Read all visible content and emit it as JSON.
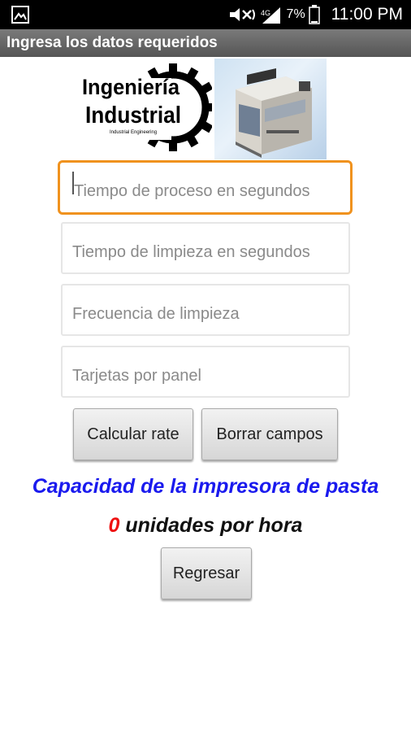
{
  "status_bar": {
    "battery_percent": "7%",
    "time": "11:00 PM",
    "icons": [
      "gallery-icon",
      "mute-icon",
      "signal-icon",
      "battery-icon"
    ]
  },
  "title_bar": {
    "title": "Ingresa los datos requeridos"
  },
  "logo": {
    "line1": "Ingeniería",
    "line2": "Industrial",
    "subtitle": "Industrial Engineering"
  },
  "form": {
    "process_time_placeholder": "Tiempo de proceso en segundos",
    "cleaning_time_placeholder": "Tiempo de limpieza en segundos",
    "cleaning_frequency_placeholder": "Frecuencia de limpieza",
    "cards_per_panel_placeholder": "Tarjetas por panel"
  },
  "buttons": {
    "calculate_label": "Calcular rate",
    "clear_label": "Borrar campos",
    "back_label": "Regresar"
  },
  "result": {
    "title": "Capacidad de la impresora de pasta",
    "count": "0",
    "unit_text": " unidades por hora"
  },
  "colors": {
    "focus_border": "#f0921e",
    "title_text": "#1a1aee",
    "count_text": "#ee1111"
  }
}
